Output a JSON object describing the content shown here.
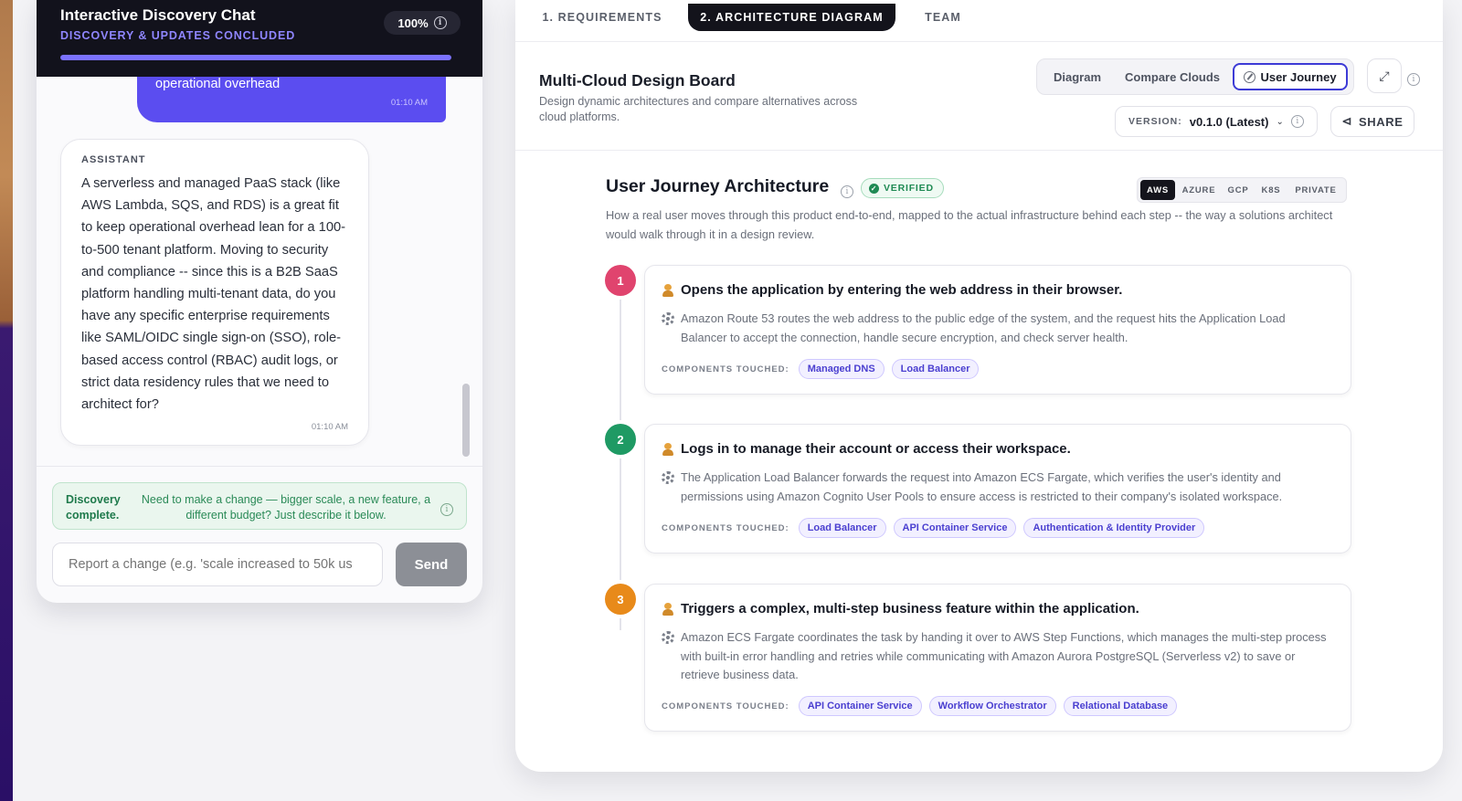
{
  "chat": {
    "title": "Interactive Discovery Chat",
    "subtitle": "DISCOVERY & UPDATES CONCLUDED",
    "progress_label": "100%",
    "progress_fraction": 1.0,
    "user_message": {
      "text": "operational overhead",
      "time": "01:10 AM"
    },
    "assistant_message": {
      "role": "ASSISTANT",
      "text": "A serverless and managed PaaS stack (like AWS Lambda, SQS, and RDS) is a great fit to keep operational overhead lean for a 100-to-500 tenant platform. Moving to security and compliance -- since this is a B2B SaaS platform handling multi-tenant data, do you have any specific enterprise requirements like SAML/OIDC single sign-on (SSO), role-based access control (RBAC) audit logs, or strict data residency rules that we need to architect for?",
      "time": "01:10 AM"
    },
    "discovery": {
      "title": "Discovery complete.",
      "text": "Need to make a change — bigger scale, a new feature, a different budget? Just describe it below."
    },
    "input_placeholder": "Report a change (e.g. 'scale increased to 50k us",
    "send_label": "Send"
  },
  "board": {
    "tabs": [
      "1. REQUIREMENTS",
      "2. ARCHITECTURE DIAGRAM",
      "TEAM"
    ],
    "active_tab": 1,
    "title": "Multi-Cloud Design Board",
    "description": "Design dynamic architectures and compare alternatives across cloud platforms.",
    "views": [
      "Diagram",
      "Compare Clouds",
      "User Journey"
    ],
    "active_view": 2,
    "version_label": "VERSION:",
    "version_value": "v0.1.0 (Latest)",
    "share_label": "SHARE"
  },
  "journey": {
    "title": "User Journey Architecture",
    "verified_label": "VERIFIED",
    "clouds": [
      "AWS",
      "AZURE",
      "GCP",
      "K8S",
      "PRIVATE"
    ],
    "active_cloud": 0,
    "description": "How a real user moves through this product end-to-end, mapped to the actual infrastructure behind each step -- the way a solutions architect would walk through it in a design review.",
    "components_label": "COMPONENTS TOUCHED:",
    "steps": [
      {
        "number": "1",
        "color": "#e0446e",
        "title": "Opens the application by entering the web address in their browser.",
        "detail": "Amazon Route 53 routes the web address to the public edge of the system, and the request hits the Application Load Balancer to accept the connection, handle secure encryption, and check server health.",
        "components": [
          "Managed DNS",
          "Load Balancer"
        ]
      },
      {
        "number": "2",
        "color": "#1f9a64",
        "title": "Logs in to manage their account or access their workspace.",
        "detail": "The Application Load Balancer forwards the request into Amazon ECS Fargate, which verifies the user's identity and permissions using Amazon Cognito User Pools to ensure access is restricted to their company's isolated workspace.",
        "components": [
          "Load Balancer",
          "API Container Service",
          "Authentication & Identity Provider"
        ]
      },
      {
        "number": "3",
        "color": "#e88a1a",
        "title": "Triggers a complex, multi-step business feature within the application.",
        "detail": "Amazon ECS Fargate coordinates the task by handing it over to AWS Step Functions, which manages the multi-step process with built-in error handling and retries while communicating with Amazon Aurora PostgreSQL (Serverless v2) to save or retrieve business data.",
        "components": [
          "API Container Service",
          "Workflow Orchestrator",
          "Relational Database"
        ]
      }
    ]
  }
}
